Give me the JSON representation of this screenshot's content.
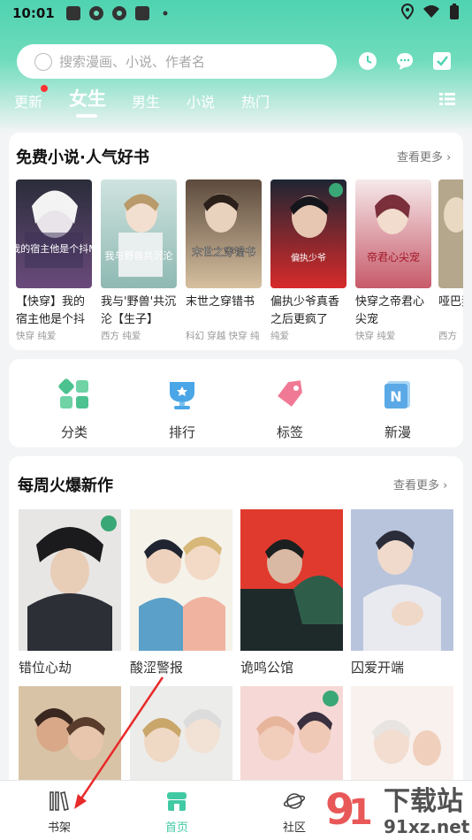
{
  "status_bar": {
    "time": "10:01"
  },
  "search": {
    "placeholder": "搜索漫画、小说、作者名"
  },
  "header_icons": [
    "clock-icon",
    "message-icon",
    "checkin-icon"
  ],
  "tabs": [
    {
      "label": "更新",
      "has_dot": true
    },
    {
      "label": "女生",
      "active": true
    },
    {
      "label": "男生"
    },
    {
      "label": "小说"
    },
    {
      "label": "热门"
    }
  ],
  "novels": {
    "title": "免费小说·人气好书",
    "more": "查看更多",
    "items": [
      {
        "title": "【快穿】我的宿主他是个抖",
        "tags": "快穿 纯爱",
        "cover_text": "我的宿主他是个抖M"
      },
      {
        "title": "我与'野兽'共沉沦【生子】",
        "tags": "西方 纯爱",
        "cover_text": "我与野兽共沉沦"
      },
      {
        "title": "末世之穿错书",
        "tags": "科幻 穿越 快穿 纯",
        "cover_text": "末世之穿错书"
      },
      {
        "title": "偏执少爷真香之后更疯了",
        "tags": "纯爱",
        "cover_text": "偏执少爷真香之后更疯了"
      },
      {
        "title": "快穿之帝君心尖宠",
        "tags": "快穿 纯爱",
        "cover_text": "帝君心尖宠"
      },
      {
        "title": "哑巴妻",
        "tags": "西方",
        "cover_text": ""
      }
    ]
  },
  "categories": [
    {
      "label": "分类",
      "icon": "category-grid-icon"
    },
    {
      "label": "排行",
      "icon": "rank-trophy-icon"
    },
    {
      "label": "标签",
      "icon": "tag-icon"
    },
    {
      "label": "新漫",
      "icon": "new-comic-icon"
    }
  ],
  "weekly": {
    "title": "每周火爆新作",
    "more": "查看更多",
    "items": [
      {
        "title": "错位心劫"
      },
      {
        "title": "酸涩警报"
      },
      {
        "title": "诡鸣公馆"
      },
      {
        "title": "囚爱开端"
      },
      {
        "title": ""
      },
      {
        "title": ""
      },
      {
        "title": ""
      },
      {
        "title": ""
      }
    ]
  },
  "bottom_nav": [
    {
      "label": "书架",
      "icon": "bookshelf-icon"
    },
    {
      "label": "首页",
      "icon": "home-icon",
      "active": true
    },
    {
      "label": "社区",
      "icon": "planet-icon"
    }
  ],
  "watermark": {
    "text": "下载站",
    "url_text": "91xz.net"
  },
  "colors": {
    "accent": "#41c9a3",
    "header_green": "#4fd3b1",
    "tag_red": "#ff3b3b"
  }
}
